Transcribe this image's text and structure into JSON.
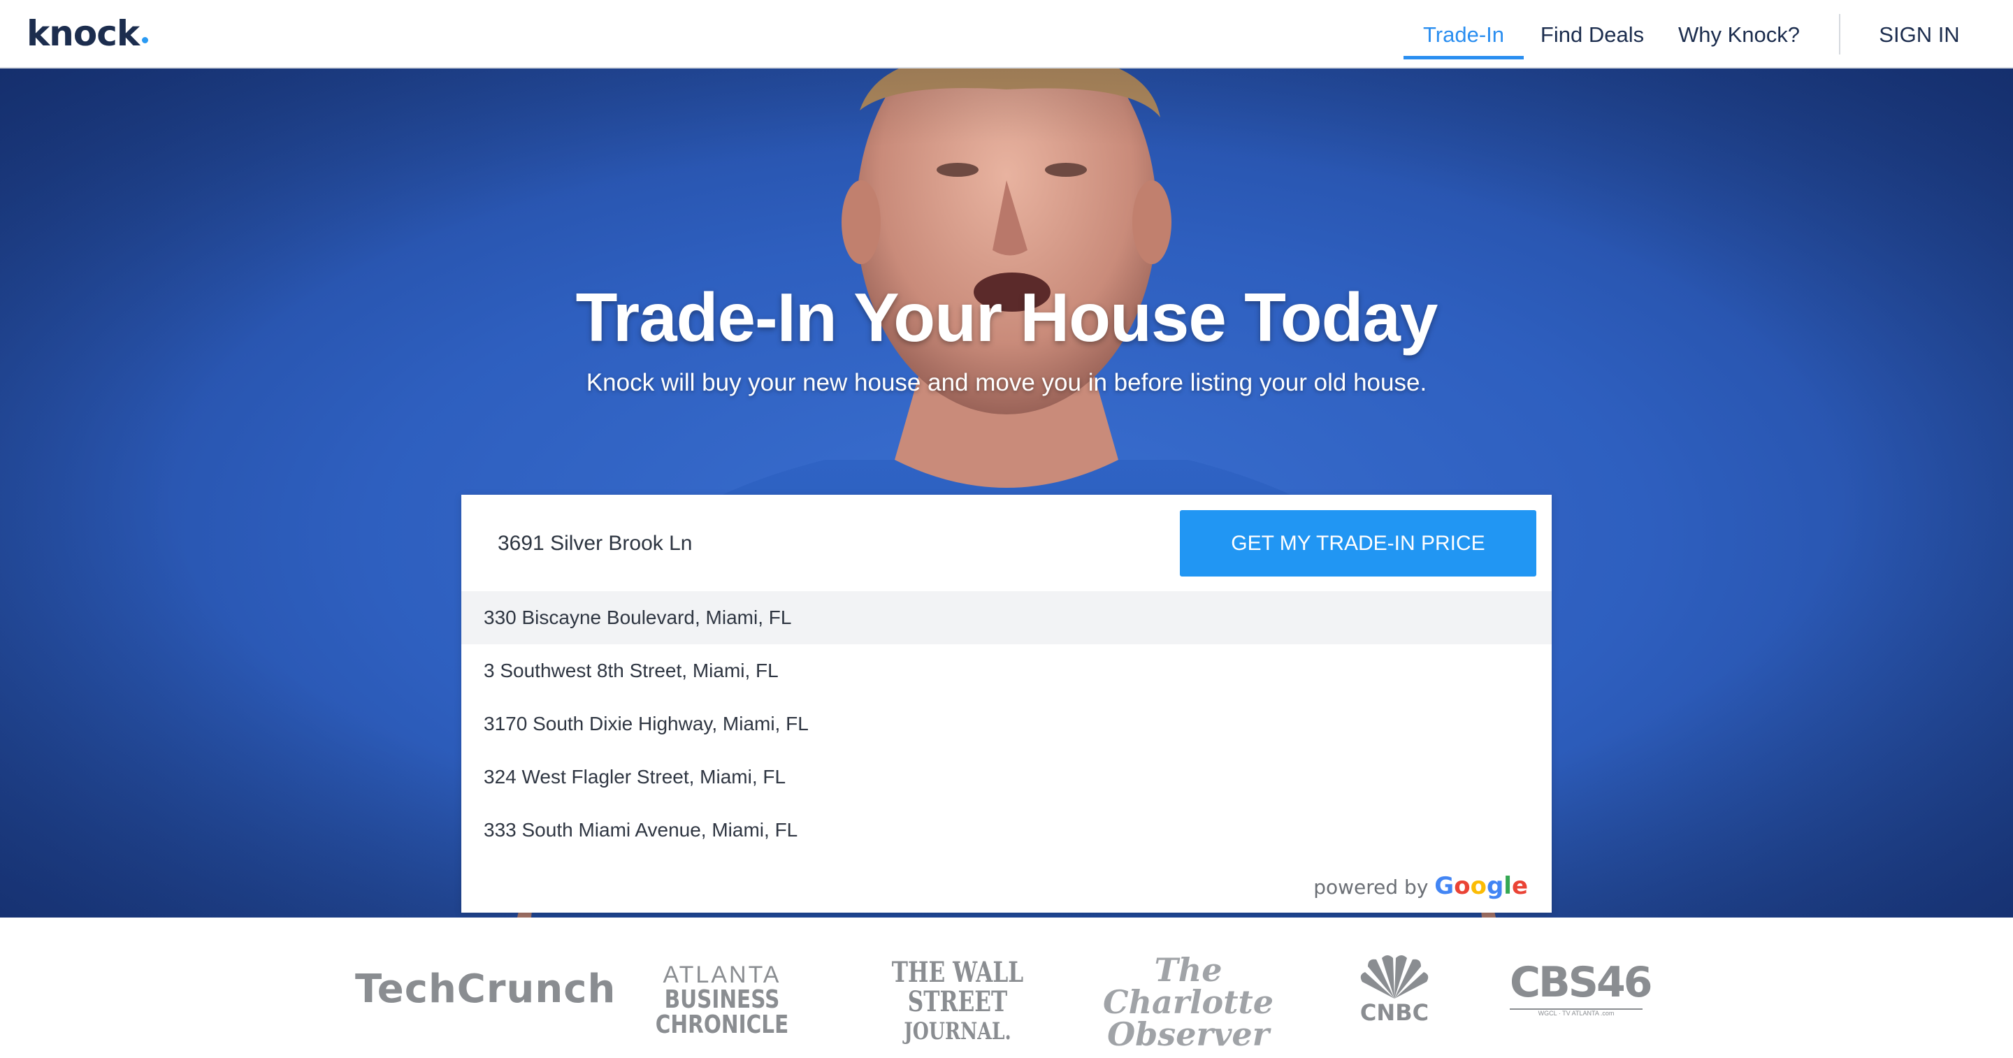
{
  "header": {
    "logo_text": "knock",
    "nav": {
      "trade_in": "Trade-In",
      "find_deals": "Find Deals",
      "why_knock": "Why Knock?",
      "sign_in": "SIGN IN"
    }
  },
  "hero": {
    "title": "Trade-In Your House Today",
    "subtitle": "Knock will buy your new house and move you in before listing your old house."
  },
  "search": {
    "address_value": "3691 Silver Brook Ln",
    "cta_label": "GET MY TRADE-IN PRICE",
    "suggestions": [
      "330 Biscayne Boulevard, Miami, FL",
      "3 Southwest 8th Street, Miami, FL",
      "3170 South Dixie Highway, Miami, FL",
      "324 West Flagler Street, Miami, FL",
      "333 South Miami Avenue, Miami, FL"
    ],
    "powered_by": "powered by",
    "powered_brand": "Google"
  },
  "press": {
    "techcrunch": "TechCrunch",
    "abc_line1": "ATLANTA",
    "abc_line2": "BUSINESS CHRONICLE",
    "wsj_line1": "THE WALL STREET",
    "wsj_line2": "JOURNAL.",
    "charlotte_line1": "The Charlotte",
    "charlotte_line2": "Observer",
    "cnbc": "CNBC",
    "cbs_text": "CBS46",
    "cbs_sub": "WGCL · TV ATLANTA   .com"
  },
  "colors": {
    "brand_navy": "#1c2d4e",
    "accent_blue": "#2a8ef0",
    "button_blue": "#2196f3",
    "hero_blue": "#2e5fbf",
    "press_gray": "#8a8d91"
  },
  "icons": {
    "logo_mark": "logo-dot",
    "nbc_peacock": "peacock-icon",
    "cbs_eye": "cbs-eye-icon",
    "google_logo": "google-logo"
  }
}
